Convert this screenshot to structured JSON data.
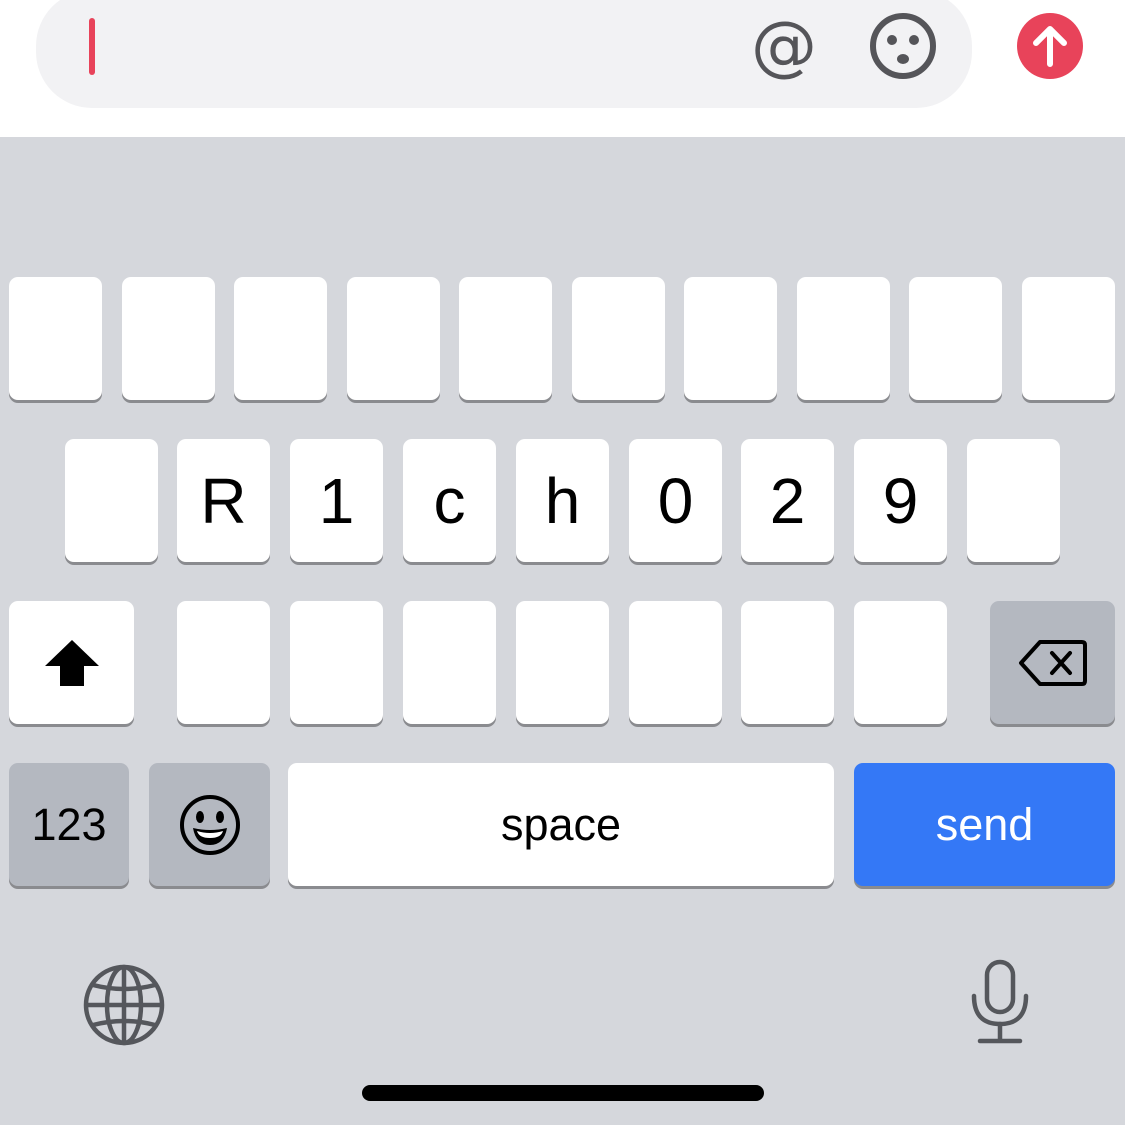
{
  "composer": {
    "text": "",
    "mention_icon": "at-icon",
    "emoji_icon": "smiley-face-icon",
    "send_icon": "arrow-up-circle-icon",
    "accent_color": "#e8435a"
  },
  "keyboard": {
    "row1": [
      "",
      "",
      "",
      "",
      "",
      "",
      "",
      "",
      "",
      ""
    ],
    "row2": [
      "",
      "R",
      "1",
      "c",
      "h",
      "0",
      "2",
      "9",
      ""
    ],
    "row3": [
      "",
      "",
      "",
      "",
      "",
      "",
      ""
    ],
    "shift_icon": "shift-arrow-icon",
    "delete_icon": "backspace-icon",
    "numbers_label": "123",
    "emoji_key_icon": "grinning-face-icon",
    "space_label": "space",
    "send_label": "send",
    "send_color": "#3478f6",
    "globe_icon": "globe-icon",
    "mic_icon": "microphone-icon"
  }
}
